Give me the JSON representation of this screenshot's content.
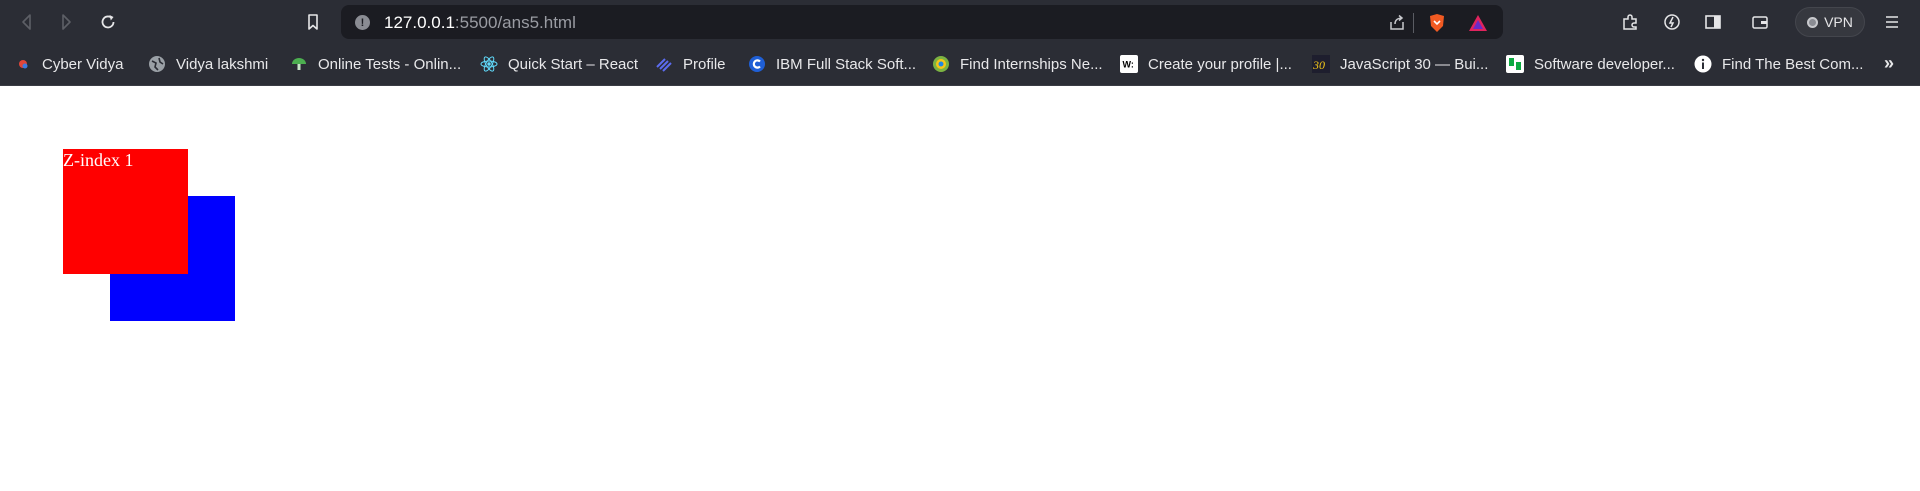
{
  "browser": {
    "url": {
      "host": "127.0.0.1",
      "rest": ":5500/ans5.html"
    },
    "toolbar_icons": [
      "back-icon",
      "forward-icon",
      "reload-icon",
      "bookmark-icon",
      "share-icon",
      "brave-shield-icon",
      "brave-rewards-icon",
      "extensions-icon",
      "leo-icon",
      "sidebar-icon",
      "wallet-icon",
      "menu-icon"
    ],
    "vpn_label": "VPN"
  },
  "bookmarks": [
    {
      "label": "Cyber Vidya",
      "icon": "cyber-vidya-icon",
      "color": "#e0463a"
    },
    {
      "label": "Vidya lakshmi",
      "icon": "globe-icon",
      "color": "#9aa0a6"
    },
    {
      "label": "Online Tests - Onlin...",
      "icon": "mushroom-icon",
      "color": "#4caf50"
    },
    {
      "label": "Quick Start – React",
      "icon": "react-icon",
      "color": "#61dafb"
    },
    {
      "label": "Profile",
      "icon": "stripes-icon",
      "color": "#5b6cf0"
    },
    {
      "label": "IBM Full Stack Soft...",
      "icon": "coursera-icon",
      "color": "#1f5fd6"
    },
    {
      "label": "Find Internships Ne...",
      "icon": "internshala-icon",
      "color": "#7cb342"
    },
    {
      "label": "Create your profile |...",
      "icon": "wellfound-icon",
      "color": "#ffffff"
    },
    {
      "label": "JavaScript 30 — Bui...",
      "icon": "js30-icon",
      "color": "#f0c419"
    },
    {
      "label": "Software developer...",
      "icon": "glassdoor-icon",
      "color": "#0caa41"
    },
    {
      "label": "Find The Best Com...",
      "icon": "info-icon",
      "color": "#ffffff"
    }
  ],
  "more_bookmarks": "»",
  "page": {
    "red_box_text": "Z-index 1",
    "red_color": "#ff0000",
    "blue_color": "#0000ff"
  }
}
